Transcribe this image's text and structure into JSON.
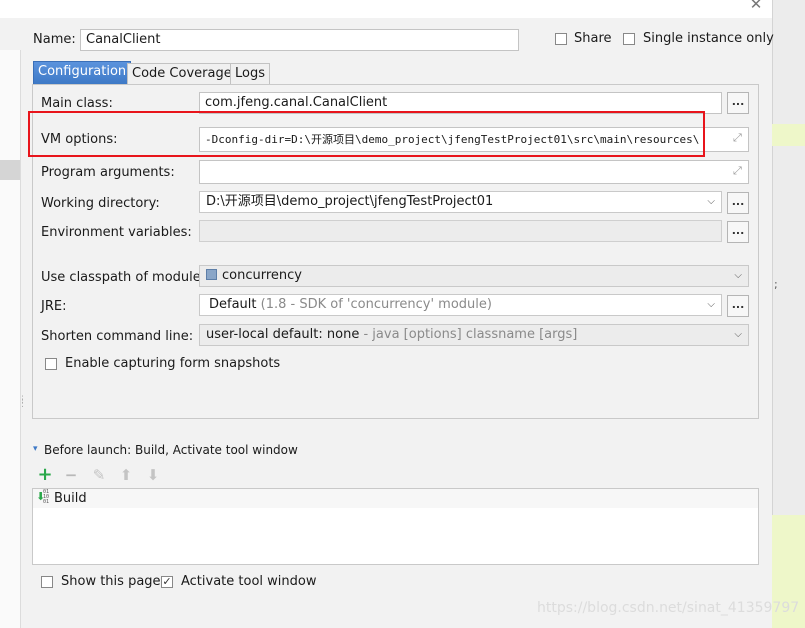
{
  "header": {
    "name_label": "Name:",
    "name_value": "CanalClient",
    "share_label": "Share",
    "single_instance_label": "Single instance only"
  },
  "tabs": [
    {
      "label": "Configuration"
    },
    {
      "label": "Code Coverage"
    },
    {
      "label": "Logs"
    }
  ],
  "config": {
    "main_class_label": "Main class:",
    "main_class_value": "com.jfeng.canal.CanalClient",
    "vm_options_label": "VM options:",
    "vm_options_value": "-Dconfig-dir=D:\\开源项目\\demo_project\\jfengTestProject01\\src\\main\\resources\\",
    "program_args_label": "Program arguments:",
    "program_args_value": "",
    "working_dir_label": "Working directory:",
    "working_dir_value": "D:\\开源项目\\demo_project\\jfengTestProject01",
    "env_vars_label": "Environment variables:",
    "env_vars_value": "",
    "classpath_label": "Use classpath of module:",
    "classpath_value": "concurrency",
    "jre_label": "JRE:",
    "jre_value": "Default",
    "jre_detail": "(1.8 - SDK of 'concurrency' module)",
    "shorten_label": "Shorten command line:",
    "shorten_value": "user-local default: none",
    "shorten_detail": "- java [options] classname [args]",
    "capture_snapshots_label": "Enable capturing form snapshots",
    "dots_label": "..."
  },
  "before_launch": {
    "title": "Before launch: Build, Activate tool window",
    "items": [
      {
        "label": "Build"
      }
    ]
  },
  "footer": {
    "show_page_label": "Show this page",
    "activate_window_label": "Activate tool window",
    "check_mark": "✓"
  },
  "icons": {
    "close": "✕",
    "chevron": "⌵",
    "expand": "⤢",
    "add": "+",
    "remove": "−",
    "edit": "✎",
    "up": "⬆",
    "down": "⬇",
    "triangle": "▾",
    "build": "⬇"
  },
  "colors": {
    "accent": "#3e79c6",
    "annotation": "#e8141b",
    "add_green": "#2aa84a"
  },
  "watermark": "https://blog.csdn.net/sinat_41359797"
}
